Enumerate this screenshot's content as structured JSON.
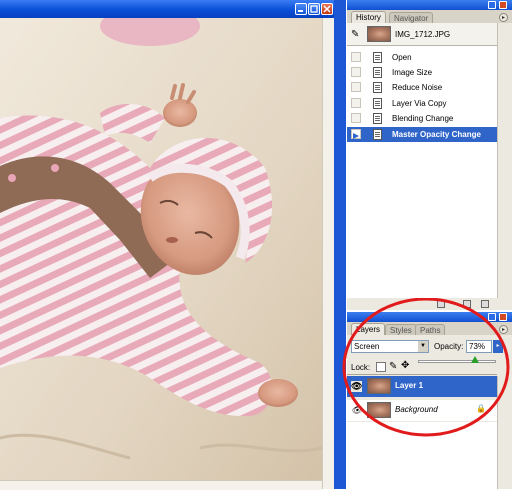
{
  "document": {
    "title_buttons": [
      "minimize",
      "maximize",
      "close"
    ]
  },
  "history_panel": {
    "tabs": [
      "History",
      "Navigator"
    ],
    "active_tab": "History",
    "snapshot": "IMG_1712.JPG",
    "items": [
      {
        "label": "Open",
        "selected": false
      },
      {
        "label": "Image Size",
        "selected": false
      },
      {
        "label": "Reduce Noise",
        "selected": false
      },
      {
        "label": "Layer Via Copy",
        "selected": false
      },
      {
        "label": "Blending Change",
        "selected": false
      },
      {
        "label": "Master Opacity Change",
        "selected": true
      }
    ]
  },
  "layers_panel": {
    "tabs": [
      "Layers",
      "Styles",
      "Paths"
    ],
    "active_tab": "Layers",
    "blend_mode": "Screen",
    "opacity_label": "Opacity:",
    "opacity_value": "73%",
    "opacity_fraction": 0.73,
    "lock_label": "Lock:",
    "layers": [
      {
        "name": "Layer 1",
        "selected": true,
        "visible": true
      },
      {
        "name": "Background",
        "selected": false,
        "visible": true,
        "locked": true
      }
    ]
  },
  "colors": {
    "title_blue": "#0a4fd8",
    "selection_blue": "#2f64c9",
    "annotation_red": "#e11b1b",
    "panel_bg": "#ece9e0"
  }
}
